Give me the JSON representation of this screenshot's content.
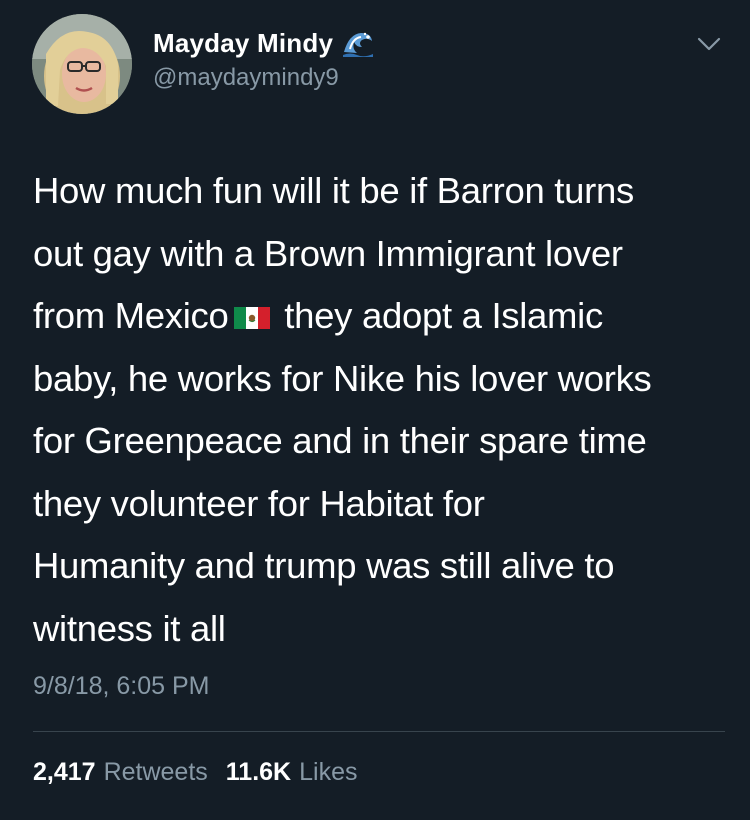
{
  "user": {
    "display_name": "Mayday Mindy",
    "handle": "@maydaymindy9",
    "name_emoji_icon": "wave-icon",
    "avatar_icon": "avatar"
  },
  "tweet": {
    "lines": [
      "How much fun will it be if Barron turns",
      "out gay with a Brown Immigrant lover",
      "from Mexico",
      " they adopt a Islamic",
      "baby, he works for Nike his lover works",
      "for Greenpeace and in their spare time",
      "they volunteer for Habitat for",
      "Humanity and trump was still alive to",
      "witness it all"
    ],
    "inline_emoji_icon": "mexico-flag-icon",
    "timestamp": "9/8/18, 6:05 PM"
  },
  "stats": {
    "retweets_count": "2,417",
    "retweets_label": "Retweets",
    "likes_count": "11.6K",
    "likes_label": "Likes"
  },
  "menu": {
    "caret_icon": "chevron-down-icon"
  },
  "colors": {
    "background": "#141d26",
    "text_primary": "#ffffff",
    "text_secondary": "#8899a6",
    "divider": "#38444d"
  }
}
